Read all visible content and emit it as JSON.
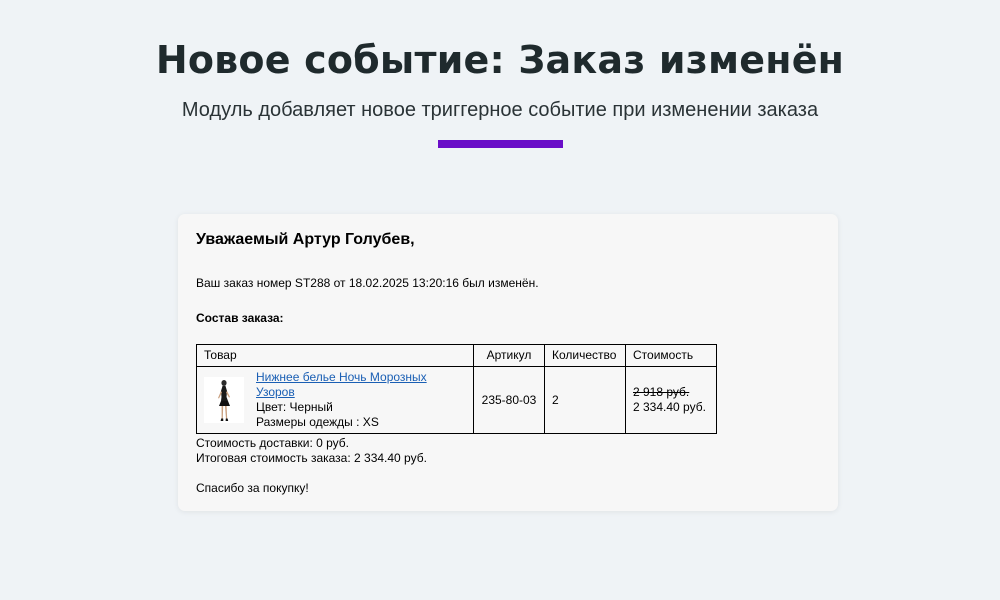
{
  "hero": {
    "title": "Новое событие: Заказ изменён",
    "subtitle": "Модуль добавляет новое триггерное событие при изменении заказа",
    "accent_color": "#6a0dc8"
  },
  "email": {
    "greeting": "Уважаемый Артур Голубев,",
    "order_message": "Ваш заказ номер ST288 от 18.02.2025 13:20:16 был изменён.",
    "composition_label": "Состав заказа:",
    "table": {
      "headers": {
        "product": "Товар",
        "sku": "Артикул",
        "quantity": "Количество",
        "cost": "Стоимость"
      },
      "rows": [
        {
          "image_icon": "product-thumbnail-icon",
          "name": "Нижнее белье Ночь Морозных Узоров",
          "color": "Цвет: Черный",
          "size": "Размеры одежды : XS",
          "sku": "235-80-03",
          "quantity": "2",
          "old_price": "2 918 руб.",
          "price": "2 334.40 руб."
        }
      ]
    },
    "delivery_cost": "Стоимость доставки: 0 руб.",
    "total_cost": "Итоговая стоимость заказа: 2 334.40 руб.",
    "thanks": "Спасибо за покупку!"
  }
}
